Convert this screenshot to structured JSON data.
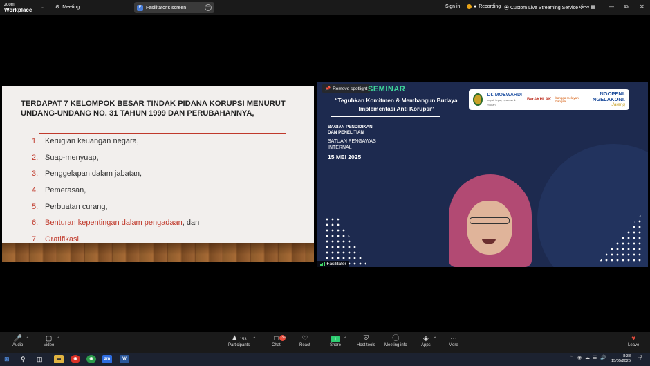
{
  "topbar": {
    "logo_line1": "zoom",
    "logo_line2": "Workplace",
    "meeting_label": "Meeting",
    "screen_label": "Fasilitator's screen",
    "screen_icon_letter": "F",
    "sign_in": "Sign in",
    "recording": "Recording",
    "live_stream": "Custom Live Streaming Service",
    "view": "View"
  },
  "slide": {
    "title": "TERDAPAT 7 KELOMPOK BESAR TINDAK PIDANA KORUPSI MENURUT UNDANG-UNDANG NO. 31 TAHUN 1999 DAN PERUBAHANNYA,",
    "items": [
      {
        "num": "1.",
        "text": "Kerugian keuangan negara,"
      },
      {
        "num": "2.",
        "text": "Suap-menyuap,"
      },
      {
        "num": "3.",
        "text": "Penggelapan dalam jabatan,"
      },
      {
        "num": "4.",
        "text": "Pemerasan,"
      },
      {
        "num": "5.",
        "text": "Perbuatan curang,"
      },
      {
        "num": "6.",
        "red": "Benturan kepentingan dalam pengadaan",
        "text": ", dan"
      },
      {
        "num": "7.",
        "red": "Gratifikasi."
      }
    ]
  },
  "camera": {
    "remove_spotlight": "Remove spotlight",
    "seminar": "SEMINAR",
    "theme": "“Teguhkan Komitmen & Membangun Budaya Implementasi Anti Korupsi”",
    "dept_line1": "BAGIAN PENDIDIKAN",
    "dept_line2": "DAN PENELITIAN",
    "unit_line1": "SATUAN PENGAWAS",
    "unit_line2": "INTERNAL",
    "date": "15 MEI 2025",
    "hospital": "Dr. MOEWARDI",
    "hospital_tag": "cepat, tepat, nyaman & mudah",
    "berakhlak": "BerAKHLAK",
    "bangga": "bangga melayani bangsa",
    "ngopeni_1": "NGOPENI.",
    "ngopeni_2": "NGELAKONI.",
    "ngopeni_3": "Jateng",
    "participant_name": "Fasilitator"
  },
  "toolbar": {
    "audio": "Audio",
    "video": "Video",
    "participants": "Participants",
    "participants_count": "153",
    "chat": "Chat",
    "chat_badge": "3",
    "react": "React",
    "share": "Share",
    "host_tools": "Host tools",
    "meeting_info": "Meeting info",
    "apps": "Apps",
    "more": "More",
    "leave": "Leave"
  },
  "taskbar": {
    "time": "8:38",
    "date": "15/05/2025",
    "notif_count": "2"
  },
  "colors": {
    "slide_accent": "#c0392b",
    "seminar_green": "#3fd69a",
    "camera_bg": "#1d2a4f",
    "recording_dot": "#e8a317",
    "share_green": "#2ecc71",
    "leave_red": "#e74c3c"
  }
}
